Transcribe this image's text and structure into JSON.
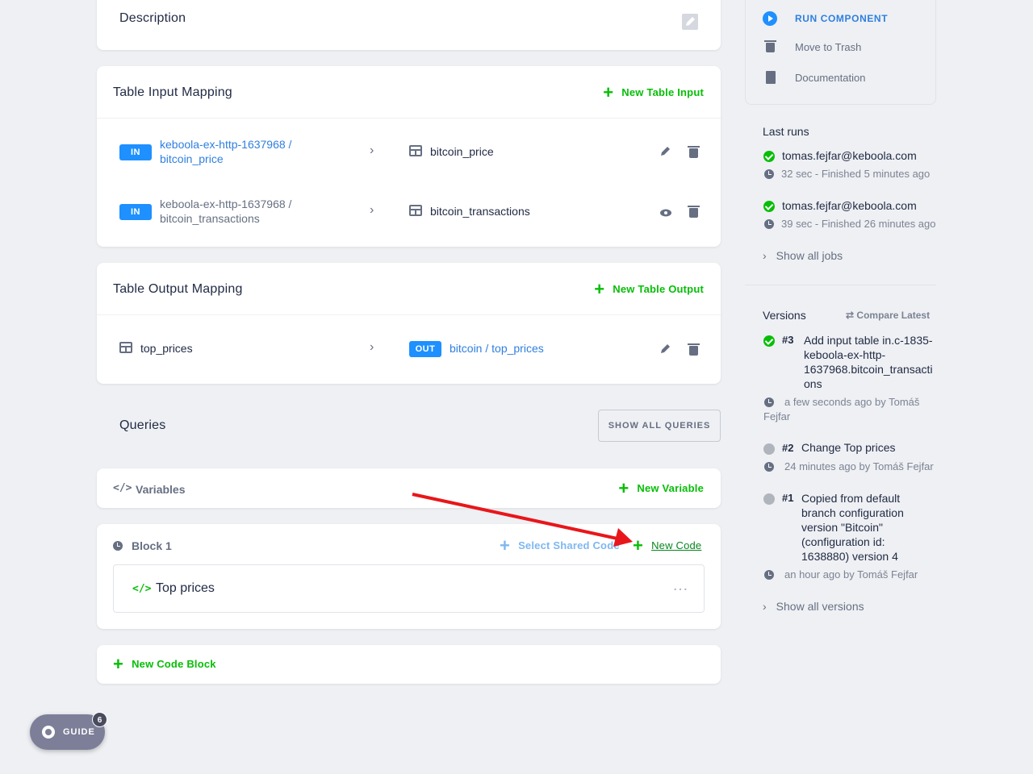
{
  "description_card": {
    "title": "Description"
  },
  "input_mapping": {
    "title": "Table Input Mapping",
    "add_label": "New Table Input",
    "rows": [
      {
        "badge": "IN",
        "source_line1": "keboola-ex-http-1637968 /",
        "source_line2": "bitcoin_price",
        "destination": "bitcoin_price"
      },
      {
        "badge": "IN",
        "source_line1": "keboola-ex-http-1637968 /",
        "source_line2": "bitcoin_transactions",
        "destination": "bitcoin_transactions"
      }
    ]
  },
  "output_mapping": {
    "title": "Table Output Mapping",
    "add_label": "New Table Output",
    "rows": [
      {
        "source": "top_prices",
        "badge": "OUT",
        "destination": "bitcoin / top_prices"
      }
    ]
  },
  "queries": {
    "title": "Queries",
    "show_all_label": "SHOW ALL QUERIES"
  },
  "variables": {
    "title": "Variables",
    "add_label": "New Variable"
  },
  "block": {
    "title": "Block 1",
    "select_shared_label": "Select Shared Code",
    "new_code_label": "New Code",
    "code_name": "Top prices"
  },
  "new_code_block_label": "New Code Block",
  "guide": {
    "label": "GUIDE",
    "count": "6"
  },
  "sidebar": {
    "actions": [
      {
        "label": "RUN COMPONENT",
        "icon": "play-circle-icon"
      },
      {
        "label": "Move to Trash",
        "icon": "trash-icon"
      },
      {
        "label": "Documentation",
        "icon": "file-icon"
      }
    ],
    "last_runs_title": "Last runs",
    "runs": [
      {
        "user": "tomas.fejfar@keboola.com",
        "detail": "32 sec - Finished 5 minutes ago"
      },
      {
        "user": "tomas.fejfar@keboola.com",
        "detail": "39 sec - Finished 26 minutes ago"
      }
    ],
    "show_all_jobs": "Show all jobs",
    "versions_title": "Versions",
    "compare_latest": "Compare Latest",
    "versions": [
      {
        "num": "#3",
        "lines": [
          "Add input table in.c-1835-",
          "keboola-ex-http-",
          "1637968.bitcoin_transacti",
          "ons"
        ],
        "meta_line1": "a few seconds ago by Tomáš",
        "meta_line2": "Fejfar"
      },
      {
        "num": "#2",
        "lines": [
          "Change Top prices"
        ],
        "meta_line1": "24 minutes ago by Tomáš Fejfar"
      },
      {
        "num": "#1",
        "lines": [
          "Copied from default",
          "branch configuration",
          "version \"Bitcoin\"",
          "(configuration id:",
          "1638880) version 4"
        ],
        "meta_line1": "an hour ago by Tomáš Fejfar"
      }
    ],
    "show_all_versions": "Show all versions"
  },
  "colors": {
    "accent_green": "#07be07",
    "accent_blue": "#1e90ff",
    "annotation_arrow": "#e8161b"
  }
}
